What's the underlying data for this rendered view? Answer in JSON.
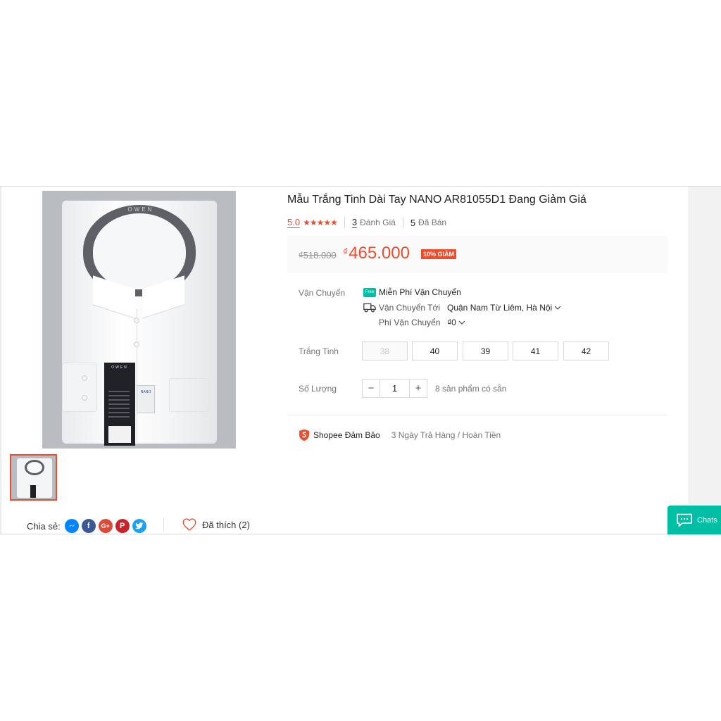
{
  "product": {
    "title": "Mẫu Trắng Tinh Dài Tay NANO AR81055D1 Đang Giảm Giá",
    "rating": "5.0",
    "stars": "★★★★★",
    "reviews_count": "3",
    "reviews_label": "Đánh Giá",
    "sold_count": "5",
    "sold_label": "Đã Bán",
    "old_price": "₫518.000",
    "currency": "₫",
    "price": "465.000",
    "discount": "10% GIẢM",
    "image_brand": "OWEN",
    "tag_brand": "OWEN",
    "tag_label": "NANO"
  },
  "shipping": {
    "label": "Vận Chuyển",
    "free_badge": "Free",
    "free_label": "Miễn Phí Vận Chuyển",
    "to_label": "Vận Chuyển Tới",
    "destination": "Quận Nam Từ Liêm, Hà Nội",
    "fee_label": "Phí Vận Chuyển",
    "fee": "₫0"
  },
  "variants": {
    "label": "Trắng Tinh",
    "options": [
      "38",
      "40",
      "39",
      "41",
      "42"
    ]
  },
  "quantity": {
    "label": "Số Lượng",
    "minus": "−",
    "value": "1",
    "plus": "+",
    "stock": "8 sản phẩm có sẵn"
  },
  "guarantee": {
    "label": "Shopee Đảm Bảo",
    "detail": "3 Ngày Trả Hàng / Hoàn Tiền"
  },
  "share": {
    "label": "Chia sẻ:",
    "networks": [
      "messenger-icon",
      "facebook-icon",
      "google-plus-icon",
      "pinterest-icon",
      "twitter-icon"
    ],
    "facebook_glyph": "f",
    "google_glyph": "G+",
    "pinterest_glyph": "P",
    "messenger_glyph": "m",
    "twitter_glyph": "t"
  },
  "like": {
    "label": "Đã thích (2)"
  },
  "chat": {
    "label": "Chats"
  },
  "colors": {
    "accent": "#ee4d2d",
    "teal": "#00bfa5",
    "messenger": "#0084ff",
    "facebook": "#3b5998",
    "google": "#db4a39",
    "pinterest": "#c8232c",
    "twitter": "#1da1f2"
  }
}
